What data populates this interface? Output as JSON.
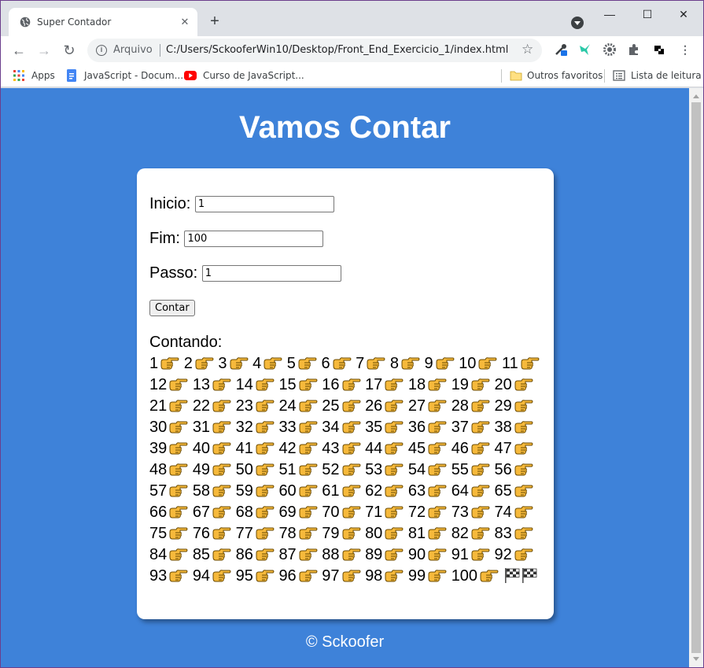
{
  "browser": {
    "tab_title": "Super Contador",
    "tab_close_icon": "close-icon",
    "new_tab_label": "+",
    "window_controls": {
      "minimize": "—",
      "maximize": "☐",
      "close": "✕"
    },
    "scheme_label": "Arquivo",
    "url": "C:/Users/SckooferWin10/Desktop/Front_End_Exercicio_1/index.html",
    "bookmarks": {
      "apps": "Apps",
      "js_doc": "JavaScript - Docum...",
      "js_course": "Curso de JavaScript...",
      "others": "Outros favoritos",
      "reading_list": "Lista de leitura"
    }
  },
  "page": {
    "title": "Vamos Contar",
    "inicio_label": "Inicio:",
    "inicio_value": "1",
    "fim_label": "Fim:",
    "fim_value": "100",
    "passo_label": "Passo:",
    "passo_value": "1",
    "button_label": "Contar",
    "result_label": "Contando:",
    "count": {
      "start": 1,
      "end": 100,
      "step": 1,
      "separator_icon": "pointing-hand-icon",
      "end_icon": "checkered-flag-icon",
      "flag_count": 2
    },
    "footer": "© Sckoofer"
  },
  "colors": {
    "page_bg": "#3e82d9",
    "card_bg": "#ffffff",
    "hand": "#f6b93b"
  }
}
